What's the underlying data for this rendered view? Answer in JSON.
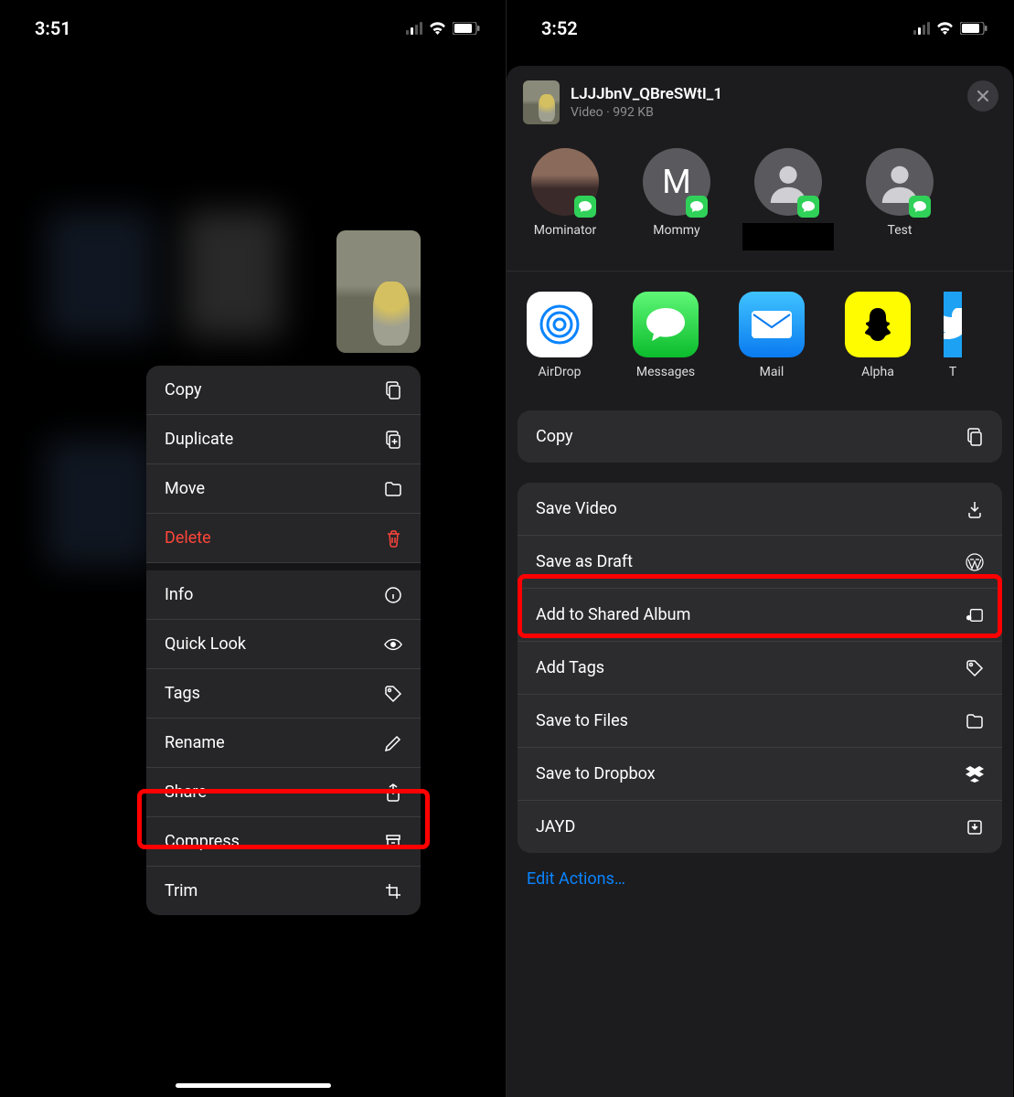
{
  "left": {
    "time": "3:51",
    "menu": {
      "copy": "Copy",
      "duplicate": "Duplicate",
      "move": "Move",
      "delete": "Delete",
      "info": "Info",
      "quicklook": "Quick Look",
      "tags": "Tags",
      "rename": "Rename",
      "share": "Share",
      "compress": "Compress",
      "trim": "Trim"
    }
  },
  "right": {
    "time": "3:52",
    "file": {
      "name": "LJJJbnV_QBreSWtI_1",
      "meta": "Video · 992 KB"
    },
    "contacts": [
      {
        "name": "Mominator",
        "type": "photo"
      },
      {
        "name": "Mommy",
        "type": "initial",
        "initial": "M"
      },
      {
        "name": "",
        "type": "redacted"
      },
      {
        "name": "Test",
        "type": "silhouette"
      }
    ],
    "apps": {
      "airdrop": "AirDrop",
      "messages": "Messages",
      "mail": "Mail",
      "alpha": "Alpha",
      "twitter": "T"
    },
    "actions": {
      "copy": "Copy",
      "save_video": "Save Video",
      "save_draft": "Save as Draft",
      "shared_album": "Add to Shared Album",
      "add_tags": "Add Tags",
      "save_files": "Save to Files",
      "dropbox": "Save to Dropbox",
      "jayd": "JAYD"
    },
    "edit_actions": "Edit Actions…"
  }
}
